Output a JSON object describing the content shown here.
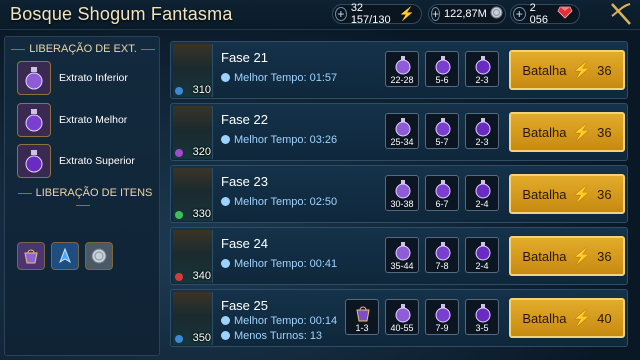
{
  "title": "Bosque Shogum Fantasma",
  "resources": {
    "energy": {
      "value": "32 157/130",
      "icon": "lightning-icon"
    },
    "silver": {
      "value": "122,87M",
      "icon": "silver-coin-icon"
    },
    "gems": {
      "value": "2 056",
      "icon": "ruby-icon"
    }
  },
  "left_panel": {
    "extract_title": "LIBERAÇÃO DE EXT.",
    "extracts": [
      {
        "label": "Extrato Inferior",
        "icon": "potion-icon",
        "color": "#8e5cd6"
      },
      {
        "label": "Extrato Melhor",
        "icon": "potion-icon",
        "color": "#7a3fd0"
      },
      {
        "label": "Extrato Superior",
        "icon": "potion-icon",
        "color": "#6a2bc2"
      }
    ],
    "items_title": "LIBERAÇÃO DE ITENS",
    "items": [
      {
        "icon": "bag-icon",
        "color": "#6b4fa0"
      },
      {
        "icon": "shard-icon",
        "color": "#2e6fb3"
      },
      {
        "icon": "silver-coin-icon",
        "color": "#7e8a96"
      }
    ]
  },
  "stages": [
    {
      "name": "Fase 21",
      "best": "Melhor Tempo: 01:57",
      "turns": "",
      "level": "310",
      "affinity": "#3a8ad6",
      "drops": [
        {
          "qty": "22-28",
          "icon": "potion-icon"
        },
        {
          "qty": "5-6",
          "icon": "potion-icon"
        },
        {
          "qty": "2-3",
          "icon": "potion-icon"
        }
      ],
      "battle_label": "Batalha",
      "energy_cost": "36"
    },
    {
      "name": "Fase 22",
      "best": "Melhor Tempo: 03:26",
      "turns": "",
      "level": "320",
      "affinity": "#a04bd0",
      "drops": [
        {
          "qty": "25-34",
          "icon": "potion-icon"
        },
        {
          "qty": "5-7",
          "icon": "potion-icon"
        },
        {
          "qty": "2-3",
          "icon": "potion-icon"
        }
      ],
      "battle_label": "Batalha",
      "energy_cost": "36"
    },
    {
      "name": "Fase 23",
      "best": "Melhor Tempo: 02:50",
      "turns": "",
      "level": "330",
      "affinity": "#3fbf5a",
      "drops": [
        {
          "qty": "30-38",
          "icon": "potion-icon"
        },
        {
          "qty": "6-7",
          "icon": "potion-icon"
        },
        {
          "qty": "2-4",
          "icon": "potion-icon"
        }
      ],
      "battle_label": "Batalha",
      "energy_cost": "36"
    },
    {
      "name": "Fase 24",
      "best": "Melhor Tempo: 00:41",
      "turns": "",
      "level": "340",
      "affinity": "#d63a3a",
      "drops": [
        {
          "qty": "35-44",
          "icon": "potion-icon"
        },
        {
          "qty": "7-8",
          "icon": "potion-icon"
        },
        {
          "qty": "2-4",
          "icon": "potion-icon"
        }
      ],
      "battle_label": "Batalha",
      "energy_cost": "36"
    },
    {
      "name": "Fase 25",
      "best": "Melhor Tempo: 00:14",
      "turns": "Menos Turnos: 13",
      "level": "350",
      "affinity": "#3a8ad6",
      "drops": [
        {
          "qty": "1-3",
          "icon": "bag-icon"
        },
        {
          "qty": "40-55",
          "icon": "potion-icon"
        },
        {
          "qty": "7-9",
          "icon": "potion-icon"
        },
        {
          "qty": "3-5",
          "icon": "potion-icon"
        }
      ],
      "battle_label": "Batalha",
      "energy_cost": "40"
    }
  ]
}
